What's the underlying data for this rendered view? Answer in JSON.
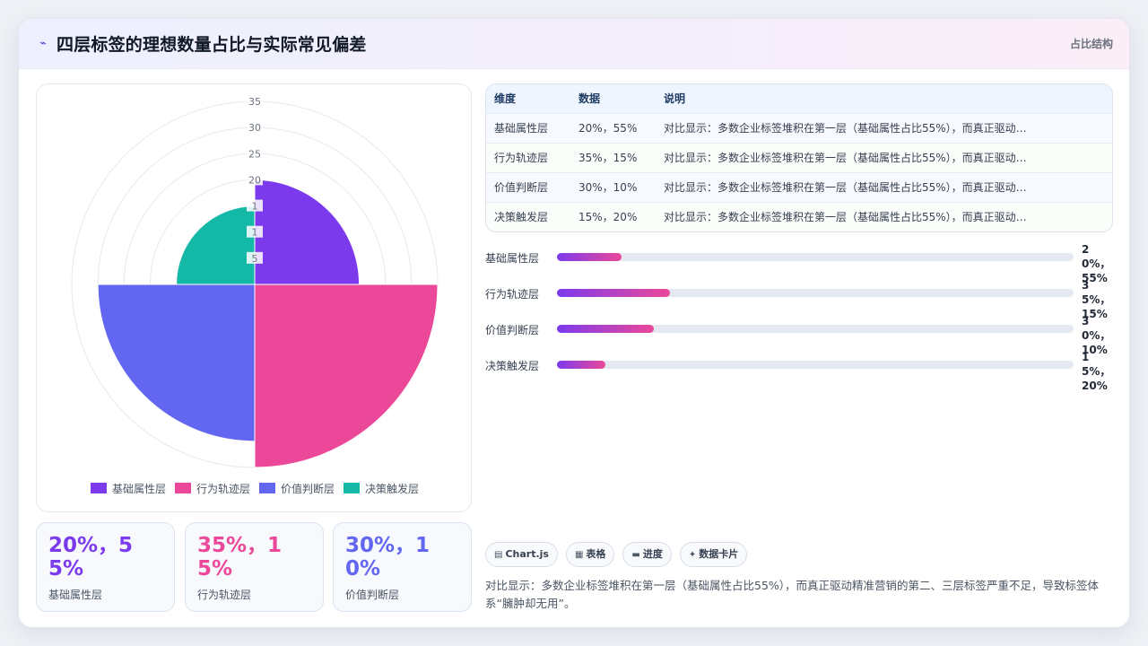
{
  "header": {
    "title": "四层标签的理想数量占比与实际常见偏差",
    "tag": "占比结构",
    "icon": "pulse-icon"
  },
  "chart_data": {
    "type": "polar-area",
    "categories": [
      "基础属性层",
      "行为轨迹层",
      "价值判断层",
      "决策触发层"
    ],
    "values": [
      20,
      35,
      30,
      15
    ],
    "colors": [
      "#7c3aed",
      "#ec4899",
      "#6366f1",
      "#14b8a6"
    ],
    "r_ticks": [
      5,
      10,
      15,
      20,
      25,
      30,
      35
    ],
    "r_tick_labels": [
      "5",
      "1",
      "1",
      "20",
      "25",
      "30",
      "35"
    ],
    "rlim": [
      0,
      35
    ],
    "legend": [
      "基础属性层",
      "行为轨迹层",
      "价值判断层",
      "决策触发层"
    ],
    "legend_position": "bottom"
  },
  "stats": [
    {
      "value": "20%，55%",
      "label": "基础属性层",
      "color": "#7c3aed"
    },
    {
      "value": "35%，15%",
      "label": "行为轨迹层",
      "color": "#ec4899"
    },
    {
      "value": "30%，10%",
      "label": "价值判断层",
      "color": "#6366f1"
    }
  ],
  "table": {
    "headers": [
      "维度",
      "数据",
      "说明"
    ],
    "rows": [
      [
        "基础属性层",
        "20%，55%",
        "对比显示：多数企业标签堆积在第一层（基础属性占比55%），而真正驱动…"
      ],
      [
        "行为轨迹层",
        "35%，15%",
        "对比显示：多数企业标签堆积在第一层（基础属性占比55%），而真正驱动…"
      ],
      [
        "价值判断层",
        "30%，10%",
        "对比显示：多数企业标签堆积在第一层（基础属性占比55%），而真正驱动…"
      ],
      [
        "决策触发层",
        "15%，20%",
        "对比显示：多数企业标签堆积在第一层（基础属性占比55%），而真正驱动…"
      ]
    ]
  },
  "bars": [
    {
      "label": "基础属性层",
      "value_text": "20%，55%",
      "fill": 0.125
    },
    {
      "label": "行为轨迹层",
      "value_text": "35%，15%",
      "fill": 0.219
    },
    {
      "label": "价值判断层",
      "value_text": "30%，10%",
      "fill": 0.188
    },
    {
      "label": "决策触发层",
      "value_text": "15%，20%",
      "fill": 0.094
    }
  ],
  "chips": [
    {
      "icon": "chart-icon",
      "glyph": "▤",
      "label": "Chart.js"
    },
    {
      "icon": "table-icon",
      "glyph": "▦",
      "label": "表格"
    },
    {
      "icon": "progress-icon",
      "glyph": "▬",
      "label": "进度"
    },
    {
      "icon": "sparkle-icon",
      "glyph": "✦",
      "label": "数据卡片"
    }
  ],
  "note": "对比显示：多数企业标签堆积在第一层（基础属性占比55%），而真正驱动精准营销的第二、三层标签严重不足，导致标签体系“臃肿却无用”。"
}
